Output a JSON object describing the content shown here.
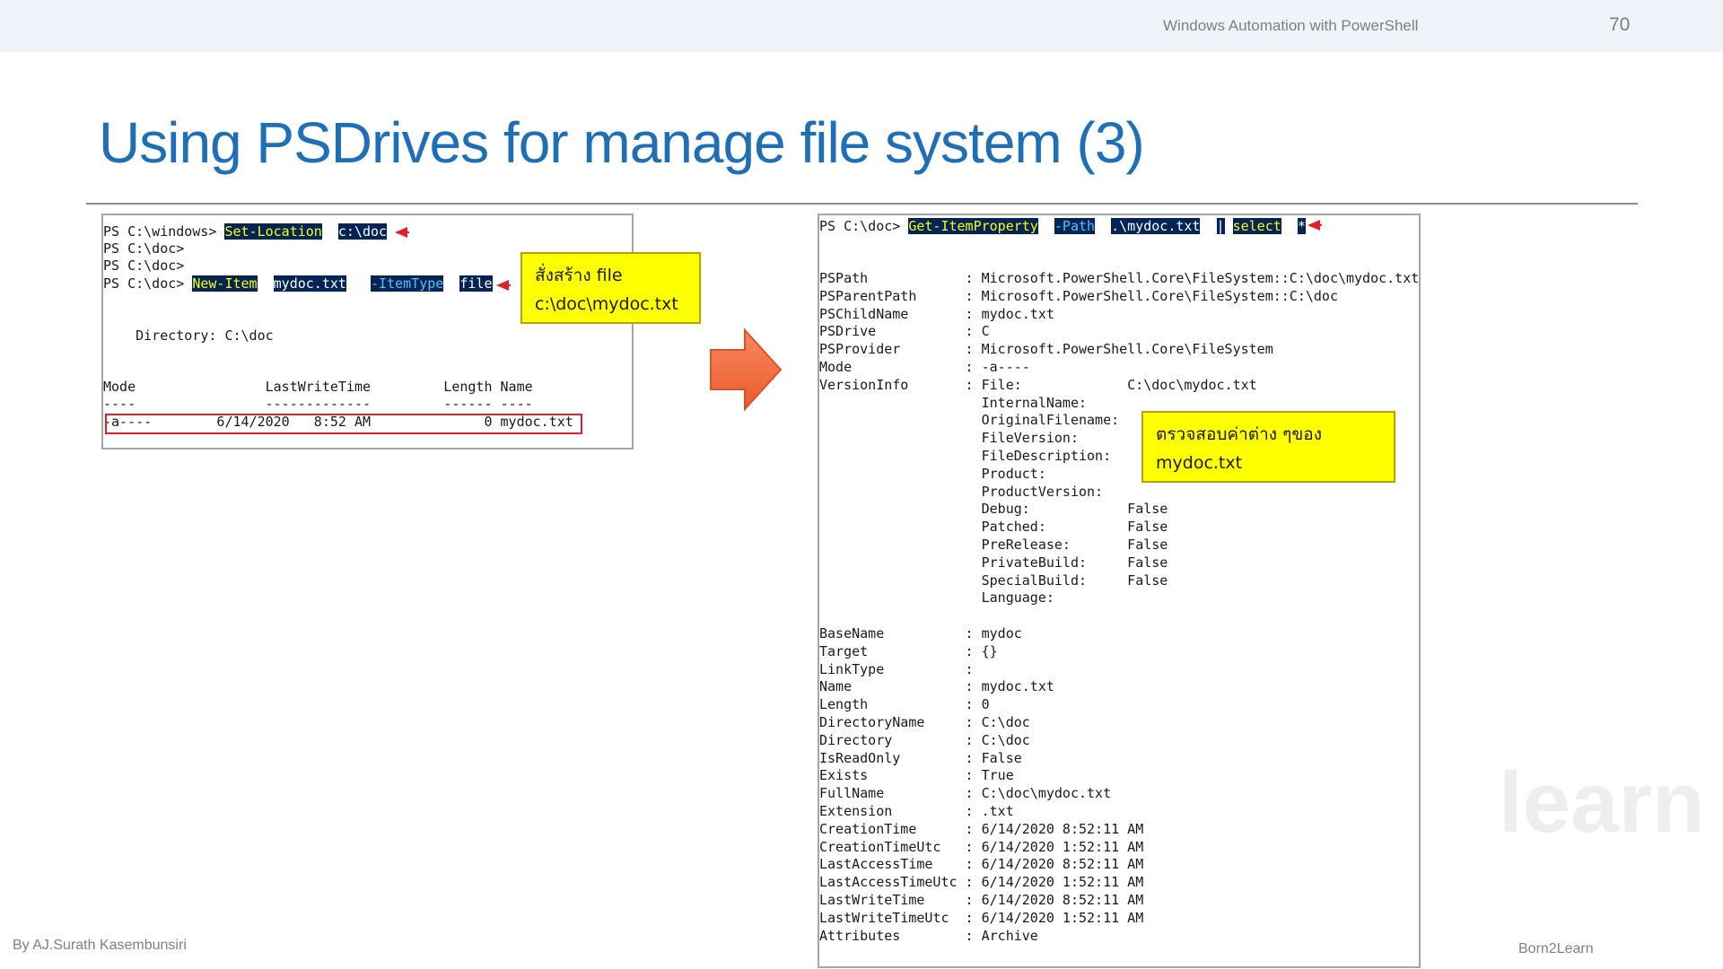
{
  "header": {
    "course_title": "Windows Automation with PowerShell",
    "page_number": "70"
  },
  "slide": {
    "title": "Using PSDrives for manage file system (3)"
  },
  "footer": {
    "author": "By AJ.Surath Kasembunsiri",
    "brand": "Born2Learn",
    "watermark": "learn"
  },
  "left_console": {
    "lines": [
      {
        "prompt": "PS C:\\windows> ",
        "parts": [
          "Set-Location",
          "c:\\doc"
        ]
      },
      {
        "text": "PS C:\\doc>"
      },
      {
        "text": "PS C:\\doc>"
      },
      {
        "prompt": "PS C:\\doc> ",
        "parts": [
          "New-Item",
          "mydoc.txt",
          "-ItemType",
          "file"
        ]
      },
      {
        "text": "    Directory: C:\\doc"
      },
      {
        "text": "Mode                LastWriteTime         Length Name"
      },
      {
        "text": "----                -------------         ------ ----"
      },
      {
        "text": "-a----        6/14/2020   8:52 AM              0 mydoc.txt"
      }
    ],
    "callout": [
      "สั่งสร้าง file",
      "c:\\doc\\mydoc.txt"
    ]
  },
  "right_console": {
    "command": {
      "prompt": "PS C:\\doc> ",
      "parts": [
        "Get-ItemProperty",
        "-Path",
        ".\\mydoc.txt",
        "|",
        "select",
        "*"
      ]
    },
    "properties": [
      {
        "name": "PSPath",
        "value": "Microsoft.PowerShell.Core\\FileSystem::C:\\doc\\mydoc.txt"
      },
      {
        "name": "PSParentPath",
        "value": "Microsoft.PowerShell.Core\\FileSystem::C:\\doc"
      },
      {
        "name": "PSChildName",
        "value": "mydoc.txt"
      },
      {
        "name": "PSDrive",
        "value": "C"
      },
      {
        "name": "PSProvider",
        "value": "Microsoft.PowerShell.Core\\FileSystem"
      },
      {
        "name": "Mode",
        "value": "-a----"
      },
      {
        "name": "VersionInfo",
        "value": "File:             C:\\doc\\mydoc.txt"
      }
    ],
    "version_info": [
      "InternalName:",
      "OriginalFilename:",
      "FileVersion:",
      "FileDescription:",
      "Product:",
      "ProductVersion:",
      "Debug:            False",
      "Patched:          False",
      "PreRelease:       False",
      "PrivateBuild:     False",
      "SpecialBuild:     False",
      "Language:"
    ],
    "properties2": [
      {
        "name": "BaseName",
        "value": "mydoc"
      },
      {
        "name": "Target",
        "value": "{}"
      },
      {
        "name": "LinkType",
        "value": ""
      },
      {
        "name": "Name",
        "value": "mydoc.txt"
      },
      {
        "name": "Length",
        "value": "0"
      },
      {
        "name": "DirectoryName",
        "value": "C:\\doc"
      },
      {
        "name": "Directory",
        "value": "C:\\doc"
      },
      {
        "name": "IsReadOnly",
        "value": "False"
      },
      {
        "name": "Exists",
        "value": "True"
      },
      {
        "name": "FullName",
        "value": "C:\\doc\\mydoc.txt"
      },
      {
        "name": "Extension",
        "value": ".txt"
      },
      {
        "name": "CreationTime",
        "value": "6/14/2020 8:52:11 AM"
      },
      {
        "name": "CreationTimeUtc",
        "value": "6/14/2020 1:52:11 AM"
      },
      {
        "name": "LastAccessTime",
        "value": "6/14/2020 8:52:11 AM"
      },
      {
        "name": "LastAccessTimeUtc",
        "value": "6/14/2020 1:52:11 AM"
      },
      {
        "name": "LastWriteTime",
        "value": "6/14/2020 8:52:11 AM"
      },
      {
        "name": "LastWriteTimeUtc",
        "value": "6/14/2020 1:52:11 AM"
      },
      {
        "name": "Attributes",
        "value": "Archive"
      }
    ],
    "callout": [
      "ตรวจสอบค่าต่าง ๆของ",
      "mydoc.txt"
    ]
  },
  "colors": {
    "title_blue": "#1f6fb7",
    "header_band": "#eef4fa",
    "highlight_bg": "#012456",
    "callout_yellow": "#ffff00",
    "arrow_orange": "#f26b43",
    "marker_red": "#e0202a"
  }
}
